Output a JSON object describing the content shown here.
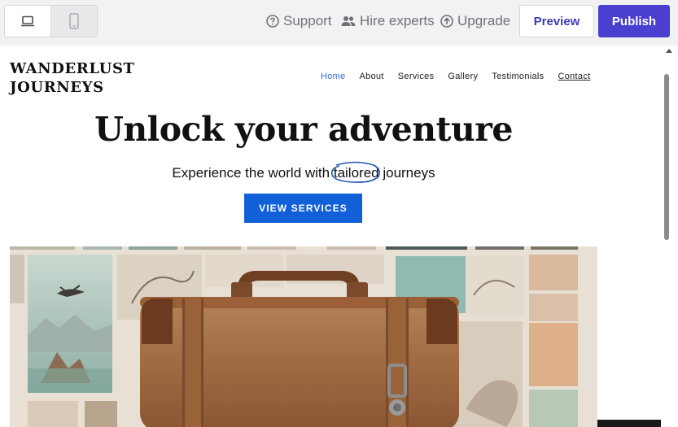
{
  "toolbar": {
    "device_desktop_icon": "laptop-icon",
    "device_mobile_icon": "mobile-icon",
    "support_label": "Support",
    "hire_label": "Hire experts",
    "upgrade_label": "Upgrade",
    "preview_label": "Preview",
    "publish_label": "Publish",
    "accent_color": "#4b3fcf"
  },
  "site": {
    "logo_line1": "WANDERLUST",
    "logo_line2": "JOURNEYS",
    "nav": {
      "home": "Home",
      "about": "About",
      "services": "Services",
      "gallery": "Gallery",
      "testimonials": "Testimonials",
      "contact": "Contact"
    },
    "hero": {
      "title": "Unlock your adventure",
      "subtitle_before": "Experience the world with ",
      "subtitle_highlight": "tailored",
      "subtitle_after": " journeys",
      "cta_label": "VIEW SERVICES",
      "cta_color": "#1160d8",
      "image_subject": "vintage leather suitcase in front of travel collage"
    }
  }
}
